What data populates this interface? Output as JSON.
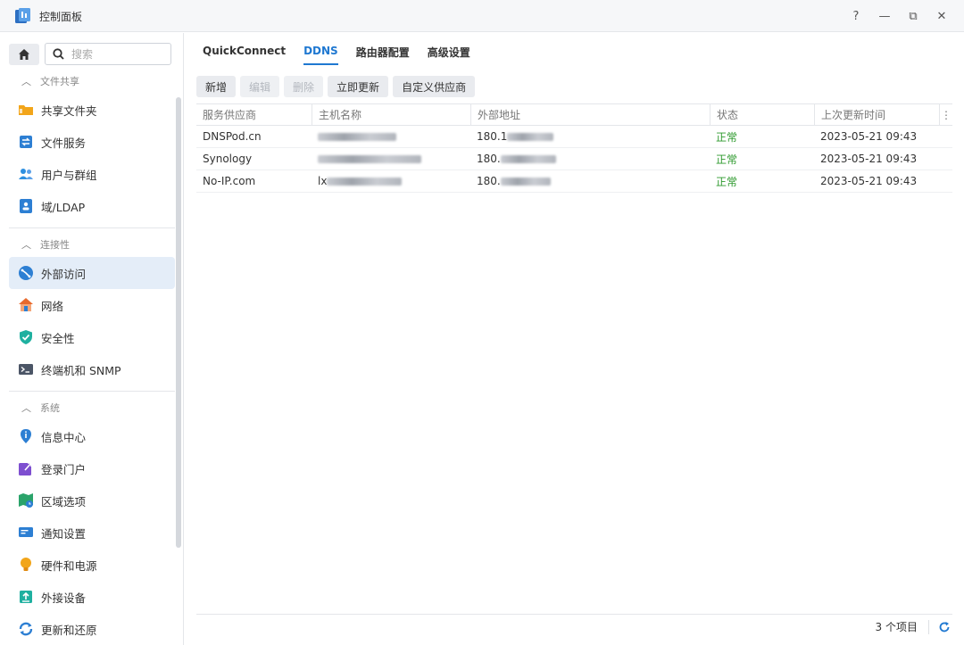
{
  "window": {
    "title": "控制面板",
    "buttons": [
      "?",
      "—",
      "⧉",
      "✕"
    ]
  },
  "sidebar": {
    "search_placeholder": "搜索",
    "sections": [
      {
        "title": "文件共享",
        "items": [
          {
            "label": "共享文件夹",
            "icon": "folder-share-icon",
            "color": "#f2a51a"
          },
          {
            "label": "文件服务",
            "icon": "file-services-icon",
            "color": "#2d7fd3"
          },
          {
            "label": "用户与群组",
            "icon": "users-icon",
            "color": "#2d8fe0"
          },
          {
            "label": "域/LDAP",
            "icon": "ldap-icon",
            "color": "#2d7fd3"
          }
        ]
      },
      {
        "title": "连接性",
        "items": [
          {
            "label": "外部访问",
            "icon": "external-access-icon",
            "color": "#2d7fd3",
            "active": true
          },
          {
            "label": "网络",
            "icon": "network-house-icon",
            "color": "#e86a2e"
          },
          {
            "label": "安全性",
            "icon": "shield-icon",
            "color": "#1fb0a0"
          },
          {
            "label": "终端机和 SNMP",
            "icon": "terminal-icon",
            "color": "#4b5566"
          }
        ]
      },
      {
        "title": "系统",
        "items": [
          {
            "label": "信息中心",
            "icon": "info-icon",
            "color": "#2d7fd3"
          },
          {
            "label": "登录门户",
            "icon": "login-portal-icon",
            "color": "#7e4fd0"
          },
          {
            "label": "区域选项",
            "icon": "region-icon",
            "color": "#2aa36a"
          },
          {
            "label": "通知设置",
            "icon": "notification-icon",
            "color": "#2d7fd3"
          },
          {
            "label": "硬件和电源",
            "icon": "bulb-icon",
            "color": "#f2a51a"
          },
          {
            "label": "外接设备",
            "icon": "external-device-icon",
            "color": "#1fb0a0"
          },
          {
            "label": "更新和还原",
            "icon": "update-icon",
            "color": "#2d7fd3"
          }
        ]
      }
    ]
  },
  "tabs": [
    {
      "label": "QuickConnect"
    },
    {
      "label": "DDNS",
      "active": true
    },
    {
      "label": "路由器配置"
    },
    {
      "label": "高级设置"
    }
  ],
  "toolbar": {
    "add": "新增",
    "edit": "编辑",
    "delete": "删除",
    "update_now": "立即更新",
    "custom_provider": "自定义供应商"
  },
  "grid": {
    "columns": [
      "服务供应商",
      "主机名称",
      "外部地址",
      "状态",
      "上次更新时间"
    ],
    "rows": [
      {
        "provider": "DNSPod.cn",
        "host_prefix": "",
        "address_prefix": "180.1",
        "status": "正常",
        "updated": "2023-05-21 09:43"
      },
      {
        "provider": "Synology",
        "host_prefix": "",
        "address_prefix": "180.",
        "status": "正常",
        "updated": "2023-05-21 09:43"
      },
      {
        "provider": "No-IP.com",
        "host_prefix": "lx",
        "address_prefix": "180.",
        "status": "正常",
        "updated": "2023-05-21 09:43"
      }
    ]
  },
  "footer": {
    "count": "3 个项目"
  },
  "colors": {
    "accent": "#1f78d1",
    "status_ok": "#2e9a2e",
    "active_bg": "#e4edf8"
  }
}
